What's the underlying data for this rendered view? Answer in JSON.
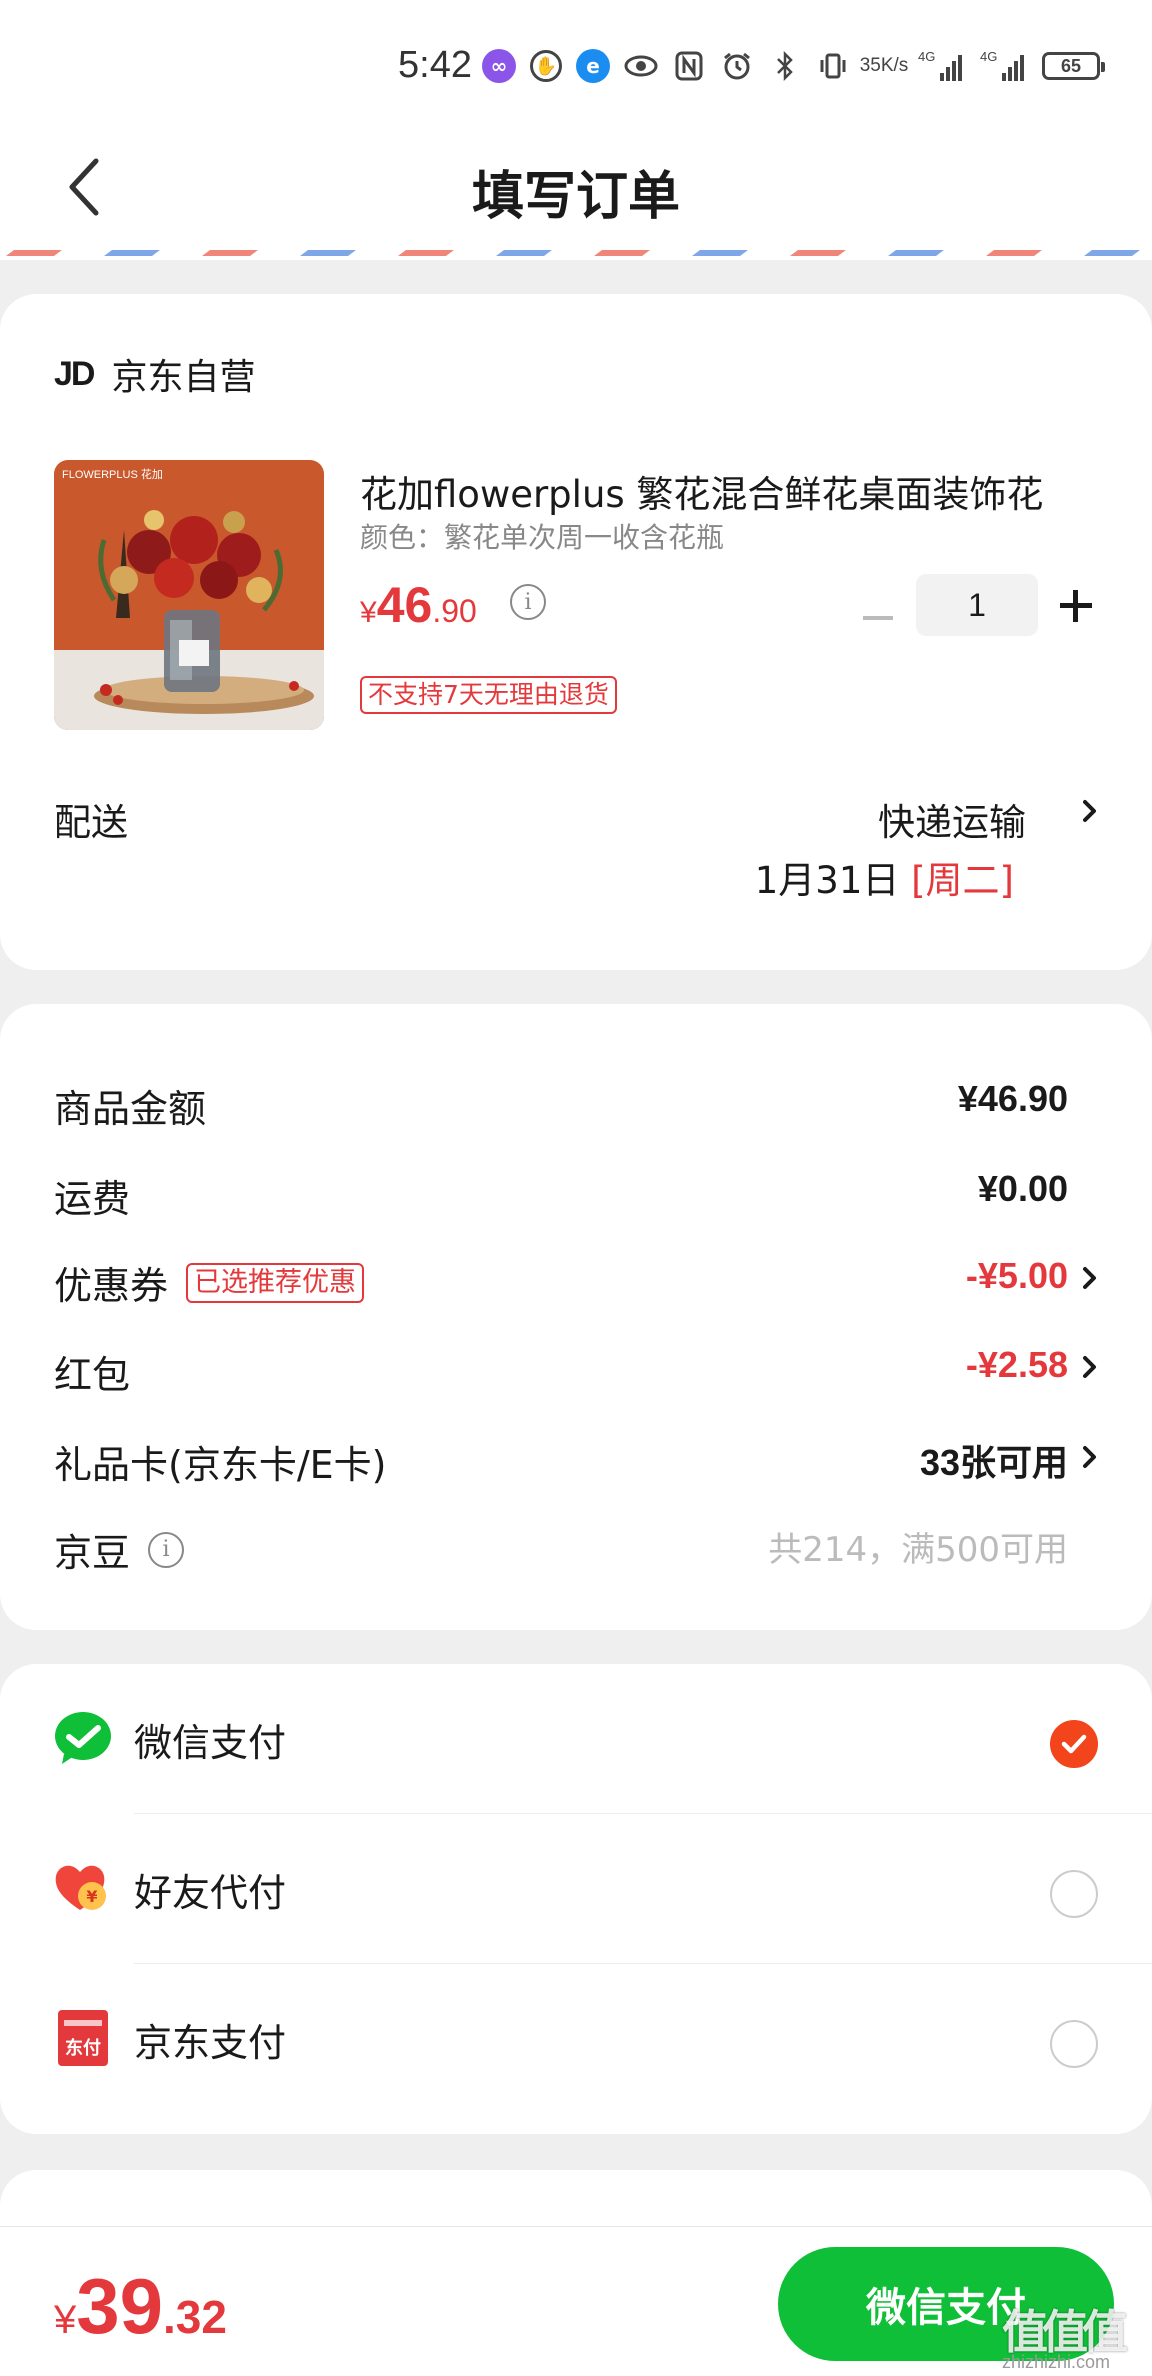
{
  "status_bar": {
    "time": "5:42",
    "net_speed_value": "35",
    "net_speed_unit": "K/s",
    "signal_tag_1": "4G",
    "signal_tag_2": "4G",
    "battery": "65"
  },
  "header": {
    "title": "填写订单"
  },
  "shop": {
    "logo": "JD",
    "name": "京东自营"
  },
  "product": {
    "title": "花加flowerplus 繁花混合鲜花桌面装饰花",
    "variant": "颜色：繁花单次周一收含花瓶",
    "price_currency": "¥",
    "price_int": "46",
    "price_dec": ".90",
    "quantity": "1",
    "return_policy": "不支持7天无理由退货",
    "thumb_brand": "FLOWERPLUS 花加"
  },
  "delivery": {
    "label": "配送",
    "method": "快递运输",
    "date": "1月31日",
    "weekday": "[周二]"
  },
  "summary": {
    "goods_label": "商品金额",
    "goods_value": "¥46.90",
    "shipping_label": "运费",
    "shipping_value": "¥0.00",
    "coupon_label": "优惠券",
    "coupon_tag": "已选推荐优惠",
    "coupon_value": "-¥5.00",
    "redpacket_label": "红包",
    "redpacket_value": "-¥2.58",
    "giftcard_label": "礼品卡(京东卡/E卡)",
    "giftcard_value": "33张可用",
    "jingdou_label": "京豆",
    "jingdou_value": "共214，满500可用"
  },
  "payment": {
    "options": [
      {
        "label": "微信支付",
        "selected": true
      },
      {
        "label": "好友代付",
        "selected": false
      },
      {
        "label": "京东支付",
        "selected": false
      }
    ],
    "jdpay_icon_text": "东付",
    "friend_icon_text": "¥"
  },
  "footer": {
    "total_currency": "¥",
    "total_int": "39",
    "total_dec": ".32",
    "pay_button": "微信支付"
  },
  "watermark": {
    "mark": "值值值",
    "site": "zhizhizhi.com"
  },
  "colors": {
    "accent_red": "#e4393c",
    "wechat_green": "#0fbf37",
    "radio_checked": "#f2451c",
    "page_bg": "#efefef"
  },
  "icons": {
    "back": "chevron-left-icon",
    "chevron": "chevron-right-icon",
    "info": "info-icon",
    "wechat": "wechat-icon",
    "friend": "heart-yuan-icon",
    "jdpay": "jd-pay-icon",
    "check": "check-icon"
  }
}
